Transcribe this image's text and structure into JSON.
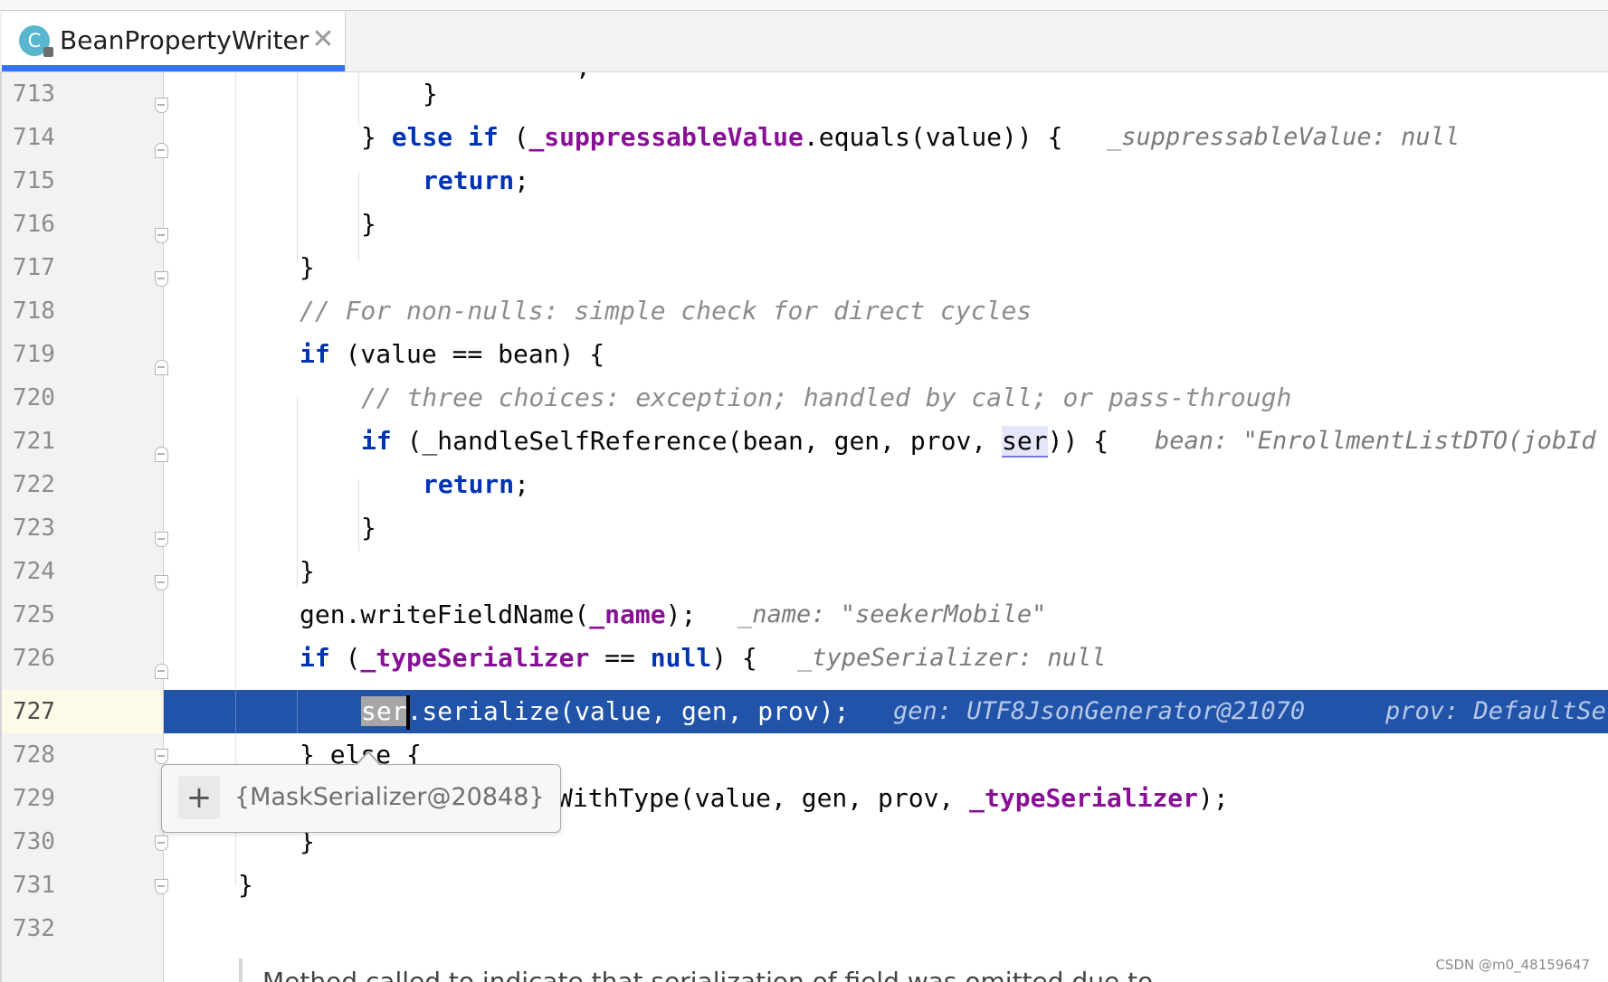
{
  "tab": {
    "icon_letter": "C",
    "title": "BeanPropertyWriter",
    "close": "✕"
  },
  "gutter": {
    "line_numbers": [
      "713",
      "714",
      "715",
      "716",
      "717",
      "718",
      "719",
      "720",
      "721",
      "722",
      "723",
      "724",
      "725",
      "726",
      "727",
      "728",
      "729",
      "730",
      "731",
      "732"
    ],
    "current_line": "727"
  },
  "code": {
    "l712_tail": ";",
    "l713": "}",
    "l714_pre": "} ",
    "l714_kw": "else if",
    "l714_open": " (",
    "l714_field": "_suppressableValue",
    "l714_rest": ".equals(value)) {",
    "l714_hint": "_suppressableValue: null",
    "l715_kw": "return",
    "l715_end": ";",
    "l716": "}",
    "l717": "}",
    "l718_comment": "// For non-nulls: simple check for direct cycles",
    "l719_kw": "if",
    "l719_rest": " (value == bean) {",
    "l720_comment": "// three choices: exception; handled by call; or pass-through",
    "l721_kw": "if",
    "l721_rest": " (_handleSelfReference(bean, gen, prov, ",
    "l721_usage": "ser",
    "l721_end": ")) {",
    "l721_hint": "bean: \"EnrollmentListDTO(jobId",
    "l722_kw": "return",
    "l722_end": ";",
    "l723": "}",
    "l724": "}",
    "l725_pre": "gen.writeFieldName(",
    "l725_field": "_name",
    "l725_end": ");",
    "l725_hint": "_name: \"seekerMobile\"",
    "l726_kw": "if",
    "l726_open": " (",
    "l726_field": "_typeSerializer",
    "l726_mid": " == ",
    "l726_kw2": "null",
    "l726_end": ") {",
    "l726_hint": "_typeSerializer: null",
    "l727_sel": "ser",
    "l727_rest": ".serialize(value, gen, prov);",
    "l727_hint1": "gen: UTF8JsonGenerator@21070",
    "l727_hint2": "prov: DefaultSe",
    "l728": "} else {",
    "l729_rest": "WithType(value, gen, prov, ",
    "l729_field": "_typeSerializer",
    "l729_end": ");",
    "l730": "}",
    "l731": "}"
  },
  "tooltip": {
    "expand_symbol": "+",
    "value": "{MaskSerializer@20848}"
  },
  "footer": {
    "doc_fragment": "Method called to indicate that serialization of field was omitted due to",
    "watermark": "CSDN @m0_48159647"
  },
  "colors": {
    "keyword": "#0033b3",
    "field": "#871094",
    "comment": "#8c8c8c",
    "execution_line": "#2154a9",
    "tab_underline": "#3574f0"
  }
}
